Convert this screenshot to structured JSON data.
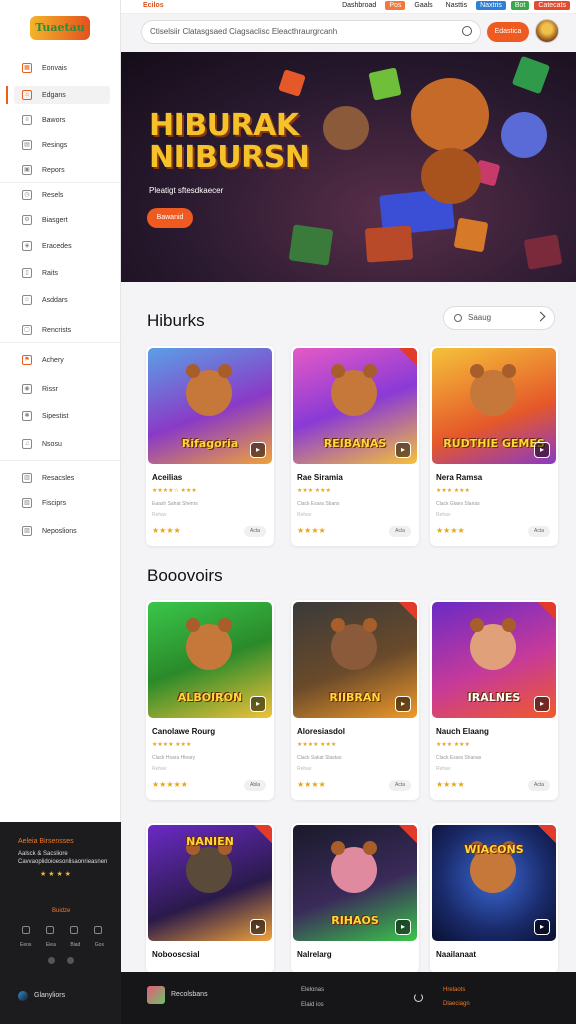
{
  "topbar": {
    "brand": "Ecilos",
    "links": [
      "Dashbroad",
      "Pos",
      "Gaals",
      "Nasttis",
      "Naxtris",
      "Bot",
      "Catecats"
    ]
  },
  "sidebar": {
    "logo": "Tuaetau",
    "items": [
      {
        "label": "Eonvais",
        "icon": "grid-icon"
      },
      {
        "label": "Edgans",
        "icon": "tag-icon"
      },
      {
        "label": "Bawors",
        "icon": "list-icon"
      },
      {
        "label": "Resings",
        "icon": "chart-icon"
      },
      {
        "label": "Repors",
        "icon": "calendar-icon"
      },
      {
        "label": "Resels",
        "icon": "clock-icon"
      },
      {
        "label": "Biasgert",
        "icon": "settings-icon"
      },
      {
        "label": "Eracedes",
        "icon": "layers-icon"
      },
      {
        "label": "Raits",
        "icon": "page-icon"
      },
      {
        "label": "Asddars",
        "icon": "user-icon"
      },
      {
        "label": "Rencrists",
        "icon": "window-icon"
      },
      {
        "label": "Achery",
        "icon": "flag-icon"
      },
      {
        "label": "Rissr",
        "icon": "pin-icon"
      },
      {
        "label": "Sipestist",
        "icon": "gear-icon"
      },
      {
        "label": "Nsosu",
        "icon": "bell-icon"
      },
      {
        "label": "Resacsles",
        "icon": "box-icon"
      },
      {
        "label": "Fisciprs",
        "icon": "doc-icon"
      },
      {
        "label": "Neposlions",
        "icon": "file-icon"
      }
    ]
  },
  "search": {
    "placeholder": "Ctiselsiir Clatasgsaed Ciagsaclisc Eleacthraurgrcanh",
    "button": "Edastica"
  },
  "hero": {
    "title_line1": "HIBURAK",
    "title_line2": "NIIBURSN",
    "subtitle": "Pleatigt sftesdkaecer",
    "cta": "Bawanid"
  },
  "section1": {
    "title": "Hiburks",
    "sort_label": "Saaug",
    "cards": [
      {
        "art": "Rifagoria",
        "name": "Aceilias",
        "meta1": "★★★★☆ ★★★",
        "meta2": "Eaash Sahat Shenrs",
        "meta3": "Rehav",
        "pill": "Acta",
        "ribbon": false
      },
      {
        "art": "REIBANAS",
        "name": "Rae Siramia",
        "meta1": "★★★ ★★★",
        "meta2": "Clack Esara Sbans",
        "meta3": "Rehav",
        "pill": "Acla",
        "ribbon": true
      },
      {
        "art": "RUDTHIE GEMES",
        "name": "Nera Ramsa",
        "meta1": "★★★ ★★★",
        "meta2": "Clack Glaes Slanas",
        "meta3": "Rehav",
        "pill": "Acta",
        "ribbon": false
      }
    ]
  },
  "section2": {
    "title": "Booovoirs",
    "cards": [
      {
        "art": "ALBOIRON",
        "name": "Canolawe Rourg",
        "meta1": "★★★★ ★★★",
        "meta2": "Clack Hsara Hleary",
        "meta3": "Rehav",
        "pill": "Abla",
        "ribbon": false
      },
      {
        "art": "RIIBRAN",
        "name": "Aloresiasdol",
        "meta1": "★★★★ ★★★",
        "meta2": "Clack Sakat Slastas",
        "meta3": "Rehav",
        "pill": "Acta",
        "ribbon": true
      },
      {
        "art": "IRALNES",
        "name": "Nauch Elaang",
        "meta1": "★★★ ★★★",
        "meta2": "Clack Esara Shanas",
        "meta3": "Rehav",
        "pill": "Acta",
        "ribbon": true
      }
    ]
  },
  "section3": {
    "cards": [
      {
        "art": "NANIEN",
        "name": "Nobooscsial",
        "ribbon": true
      },
      {
        "art": "RIHAOS",
        "name": "Nalrelarg",
        "ribbon": true
      },
      {
        "art": "WIACONS",
        "name": "Naailanaat",
        "ribbon": true
      }
    ]
  },
  "darkpanel": {
    "title": "Aeleia Birsensses",
    "text": "Aalsck & Sacsliore Cavvaoplidoioesonlisaonrieasnen",
    "stars": "★ ★ ★ ★",
    "section": "Buidze",
    "labels": [
      "Eeos",
      "Eiea",
      "Biad",
      "Gos"
    ],
    "brand": "Glanyliors"
  },
  "footer": {
    "brand": "Recolsbans",
    "link1": "Elelonas",
    "link2": "Elaid ios",
    "link3": "Hrelaots",
    "link4": "Dlaeciagn"
  }
}
